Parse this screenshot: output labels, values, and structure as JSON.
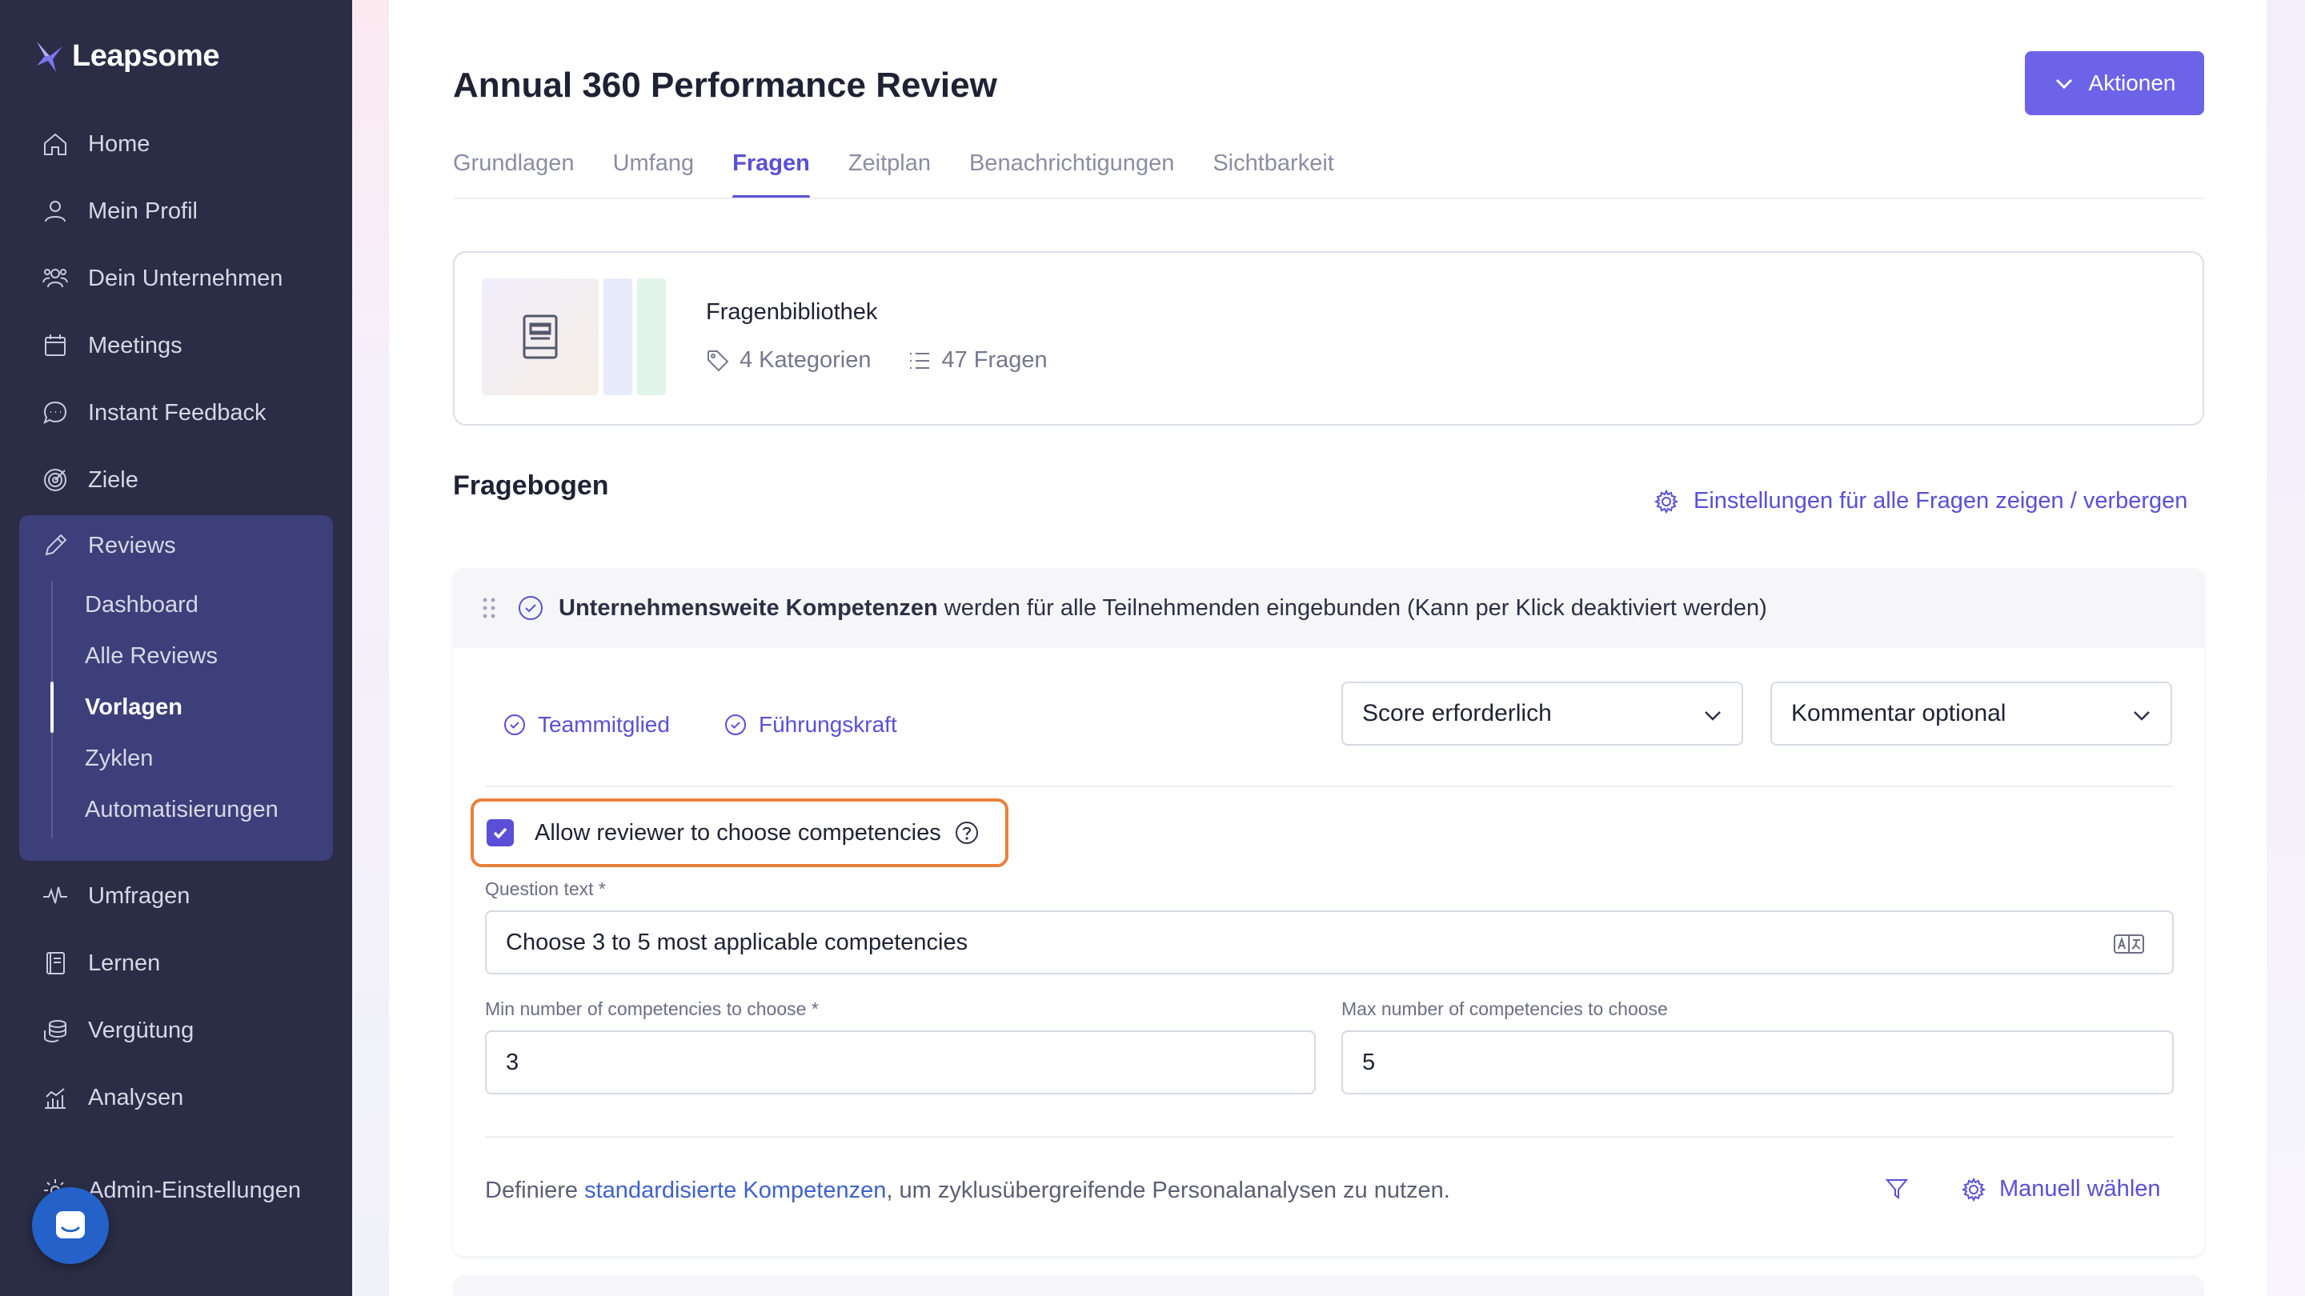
{
  "brand": {
    "name": "Leapsome"
  },
  "sidebar": {
    "items": [
      {
        "label": "Home",
        "icon": "home-icon"
      },
      {
        "label": "Mein Profil",
        "icon": "user-icon"
      },
      {
        "label": "Dein Unternehmen",
        "icon": "users-icon"
      },
      {
        "label": "Meetings",
        "icon": "calendar-icon"
      },
      {
        "label": "Instant Feedback",
        "icon": "chat-icon"
      },
      {
        "label": "Ziele",
        "icon": "target-icon"
      },
      {
        "label": "Reviews",
        "icon": "pencil-icon"
      },
      {
        "label": "Umfragen",
        "icon": "pulse-icon"
      },
      {
        "label": "Lernen",
        "icon": "book-icon"
      },
      {
        "label": "Vergütung",
        "icon": "coins-icon"
      },
      {
        "label": "Analysen",
        "icon": "chart-icon"
      },
      {
        "label": "Admin-Einstellungen",
        "icon": "gear-icon"
      }
    ],
    "reviews_sub": [
      {
        "label": "Dashboard"
      },
      {
        "label": "Alle Reviews"
      },
      {
        "label": "Vorlagen",
        "active": true
      },
      {
        "label": "Zyklen"
      },
      {
        "label": "Automatisierungen"
      }
    ]
  },
  "header": {
    "title": "Annual 360 Performance Review",
    "actions_label": "Aktionen"
  },
  "tabs": [
    {
      "label": "Grundlagen"
    },
    {
      "label": "Umfang"
    },
    {
      "label": "Fragen",
      "active": true
    },
    {
      "label": "Zeitplan"
    },
    {
      "label": "Benachrichtigungen"
    },
    {
      "label": "Sichtbarkeit"
    }
  ],
  "library": {
    "title": "Fragenbibliothek",
    "categories": "4 Kategorien",
    "questions": "47 Fragen"
  },
  "questionnaire": {
    "title": "Fragebogen",
    "settings_link": "Einstellungen für alle Fragen zeigen / verbergen",
    "card": {
      "header_bold": "Unternehmensweite Kompetenzen",
      "header_rest": "werden für alle Teilnehmenden eingebunden (Kann per Klick deaktiviert werden)",
      "roles": [
        "Teammitglied",
        "Führungskraft"
      ],
      "score_select": "Score erforderlich",
      "comment_select": "Kommentar optional",
      "allow_choose_label": "Allow reviewer to choose competencies",
      "allow_choose_checked": true,
      "question_text_label": "Question text *",
      "question_text_value": "Choose 3 to 5 most applicable competencies",
      "min_label": "Min number of competencies to choose *",
      "min_value": "3",
      "max_label": "Max number of competencies to choose",
      "max_value": "5",
      "footer_prefix": "Definiere",
      "footer_link": "standardisierte Kompetenzen",
      "footer_suffix": ", um zyklusübergreifende Personalanalysen zu nutzen.",
      "manual_label": "Manuell wählen"
    }
  },
  "colors": {
    "sidebar_bg": "#2a2d45",
    "sidebar_active_bg": "#3d3f7a",
    "accent": "#5a4fd6",
    "button": "#6d63e8",
    "highlight": "#e8813c"
  }
}
